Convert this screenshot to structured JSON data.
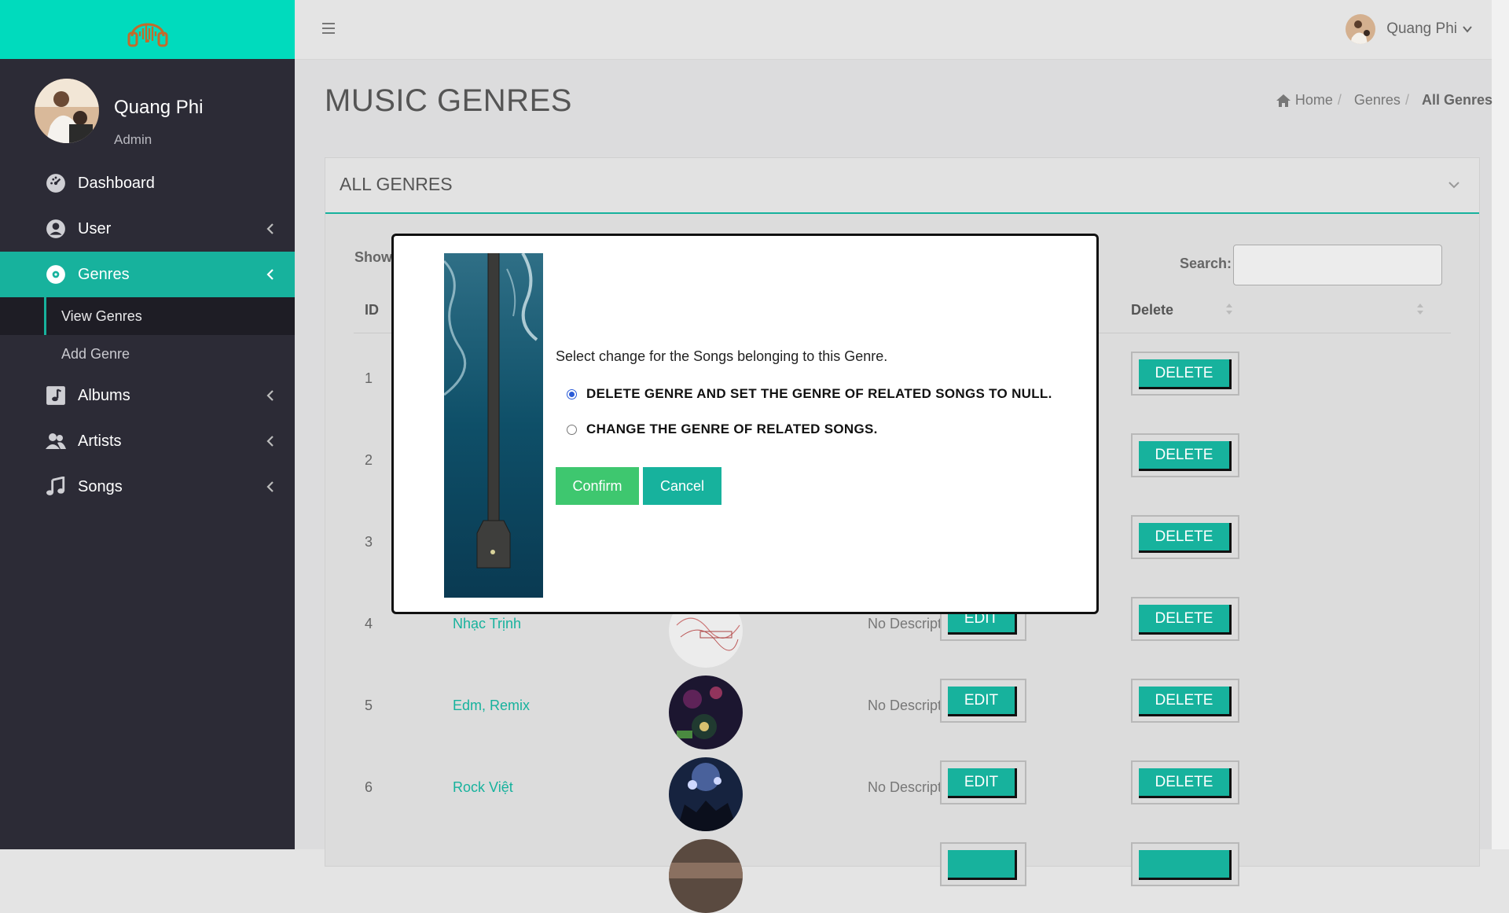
{
  "sidebar": {
    "user": {
      "name": "Quang Phi",
      "role": "Admin"
    },
    "items": [
      {
        "label": "Dashboard",
        "icon": "dashboard-icon"
      },
      {
        "label": "User",
        "icon": "user-circle-icon"
      },
      {
        "label": "Genres",
        "icon": "disc-icon"
      },
      {
        "label": "Albums",
        "icon": "music-square-icon"
      },
      {
        "label": "Artists",
        "icon": "users-icon"
      },
      {
        "label": "Songs",
        "icon": "music-note-icon"
      }
    ],
    "genres_sub": [
      {
        "label": "View Genres"
      },
      {
        "label": "Add Genre"
      }
    ]
  },
  "topbar": {
    "user_name": "Quang Phi"
  },
  "page": {
    "title": "MUSIC GENRES"
  },
  "breadcrumb": {
    "home": "Home",
    "genres": "Genres",
    "current": "All Genres"
  },
  "card": {
    "title": "ALL GENRES"
  },
  "table": {
    "show_label": "Show",
    "search_label": "Search:",
    "search_value": "",
    "headers": {
      "id": "ID",
      "delete": "Delete"
    },
    "edit_label": "EDIT",
    "delete_label": "DELETE",
    "rows": [
      {
        "id": "1",
        "name": "",
        "desc": ""
      },
      {
        "id": "2",
        "name": "",
        "desc": ""
      },
      {
        "id": "3",
        "name": "",
        "desc": ""
      },
      {
        "id": "4",
        "name": "Nhạc Trịnh",
        "desc": "No Description"
      },
      {
        "id": "5",
        "name": "Edm, Remix",
        "desc": "No Description"
      },
      {
        "id": "6",
        "name": "Rock Việt",
        "desc": "No Description"
      }
    ]
  },
  "modal": {
    "message": "Select change for the Songs belonging to this Genre.",
    "options": [
      {
        "label": "DELETE GENRE AND SET THE GENRE OF RELATED SONGS TO NULL.",
        "selected": true
      },
      {
        "label": "CHANGE THE GENRE OF RELATED SONGS.",
        "selected": false
      }
    ],
    "confirm": "Confirm",
    "cancel": "Cancel"
  },
  "colors": {
    "accent": "#17b29d",
    "logo_bar": "#00dbbd",
    "sidebar_bg": "#2c2b36",
    "confirm": "#3ec76f"
  }
}
